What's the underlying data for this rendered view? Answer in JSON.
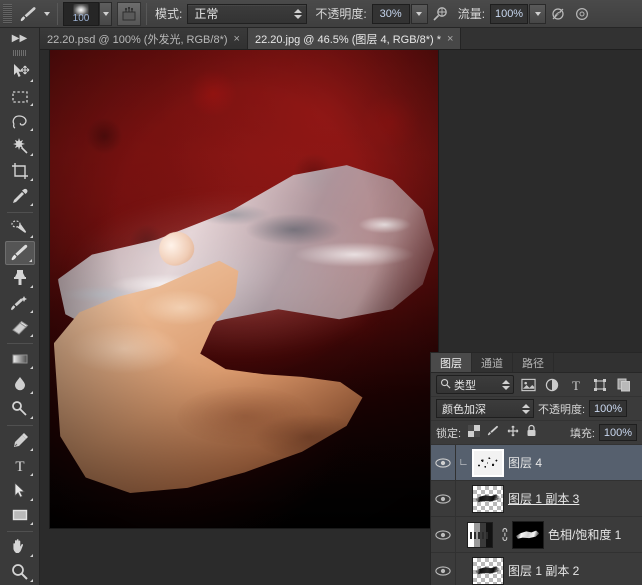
{
  "options_bar": {
    "tool_icon": "brush-tool-icon",
    "tool_preset_arrow": "chevron-down-icon",
    "brush_size": "100",
    "brush_panel_icon": "brush-panel-icon",
    "mode_label": "模式:",
    "mode_value": "正常",
    "opacity_label": "不透明度:",
    "opacity_value": "30%",
    "airbrush_icon": "airbrush-icon",
    "flow_label": "流量:",
    "flow_value": "100%",
    "smoothing_icon": "smoothing-icon",
    "extra_icon": "tablet-pressure-icon"
  },
  "tab_bar": {
    "collapse_icon": "expand-arrows-icon",
    "tabs": [
      {
        "title": "22.20.psd @ 100% (外发光, RGB/8*)",
        "close": "×",
        "active": false
      },
      {
        "title": "22.20.jpg @ 46.5% (图层 4, RGB/8*) *",
        "close": "×",
        "active": true
      }
    ]
  },
  "toolbar": {
    "collapse_icon": "double-chevron-right-icon",
    "tools": [
      {
        "name": "move-tool",
        "icon": "move-tool-icon",
        "active": false
      },
      {
        "name": "marquee-tool",
        "icon": "rectangular-marquee-icon",
        "active": false
      },
      {
        "name": "lasso-tool",
        "icon": "lasso-icon",
        "active": false
      },
      {
        "name": "magic-wand-tool",
        "icon": "magic-wand-icon",
        "active": false
      },
      {
        "name": "crop-tool",
        "icon": "crop-icon",
        "active": false
      },
      {
        "name": "eyedropper-tool",
        "icon": "eyedropper-icon",
        "active": false
      },
      {
        "name": "healing-brush-tool",
        "icon": "healing-brush-icon",
        "active": false
      },
      {
        "name": "brush-tool",
        "icon": "brush-icon",
        "active": true
      },
      {
        "name": "clone-stamp-tool",
        "icon": "clone-stamp-icon",
        "active": false
      },
      {
        "name": "history-brush-tool",
        "icon": "history-brush-icon",
        "active": false
      },
      {
        "name": "eraser-tool",
        "icon": "eraser-icon",
        "active": false
      },
      {
        "name": "gradient-tool",
        "icon": "gradient-icon",
        "active": false
      },
      {
        "name": "blur-tool",
        "icon": "blur-drop-icon",
        "active": false
      },
      {
        "name": "dodge-tool",
        "icon": "dodge-icon",
        "active": false
      },
      {
        "name": "pen-tool",
        "icon": "pen-icon",
        "active": false
      },
      {
        "name": "type-tool",
        "icon": "type-T-icon",
        "active": false
      },
      {
        "name": "path-selection-tool",
        "icon": "path-arrow-icon",
        "active": false
      },
      {
        "name": "rectangle-tool",
        "icon": "rectangle-shape-icon",
        "active": false
      },
      {
        "name": "hand-tool",
        "icon": "hand-icon",
        "active": false
      },
      {
        "name": "zoom-tool",
        "icon": "magnifier-icon",
        "active": false
      }
    ]
  },
  "canvas": {
    "description": "translucent glass hand resting above a human hand on dark red textured background"
  },
  "layers_panel": {
    "tabs": [
      {
        "label": "图层",
        "active": true
      },
      {
        "label": "通道",
        "active": false
      },
      {
        "label": "路径",
        "active": false
      }
    ],
    "filter": {
      "search_icon": "search-icon",
      "kind_value": "类型",
      "icons": [
        "filter-pixel-icon",
        "filter-adjustment-icon",
        "filter-type-icon",
        "filter-shape-icon",
        "filter-smart-object-icon"
      ]
    },
    "blend_mode": "颜色加深",
    "opacity_label": "不透明度:",
    "opacity_value": "100%",
    "lock_label": "锁定:",
    "lock_icons": [
      "lock-transparent-pixels-icon",
      "lock-image-pixels-icon",
      "lock-position-icon",
      "lock-all-icon"
    ],
    "fill_label": "填充:",
    "fill_value": "100%",
    "layers": [
      {
        "name": "图层 4",
        "visible": true,
        "visibility_icon": "eye-icon",
        "selected": true,
        "clipped": true,
        "clip_icon": "clipping-mask-arrow-icon",
        "thumb": "speckle",
        "linked": false
      },
      {
        "name": "图层 1 副本 3",
        "visible": true,
        "visibility_icon": "eye-icon",
        "selected": false,
        "clipped": false,
        "thumb": "hand-transparent",
        "linked": true
      },
      {
        "name": "色相/饱和度 1",
        "visible": true,
        "visibility_icon": "eye-icon",
        "selected": false,
        "clipped": false,
        "thumb": "adjustment",
        "link_icon": "link-icon",
        "mask": true,
        "linked": false
      },
      {
        "name": "图层 1 副本 2",
        "visible": true,
        "visibility_icon": "eye-icon",
        "selected": false,
        "clipped": false,
        "thumb": "hand-transparent",
        "linked": false
      }
    ]
  },
  "colors": {
    "chrome": "#3b3b3b",
    "options_bar": "#464646",
    "selection_blue": "#56606e",
    "accent_text": "#c9d7ef",
    "canvas_red": "#7d1412"
  }
}
